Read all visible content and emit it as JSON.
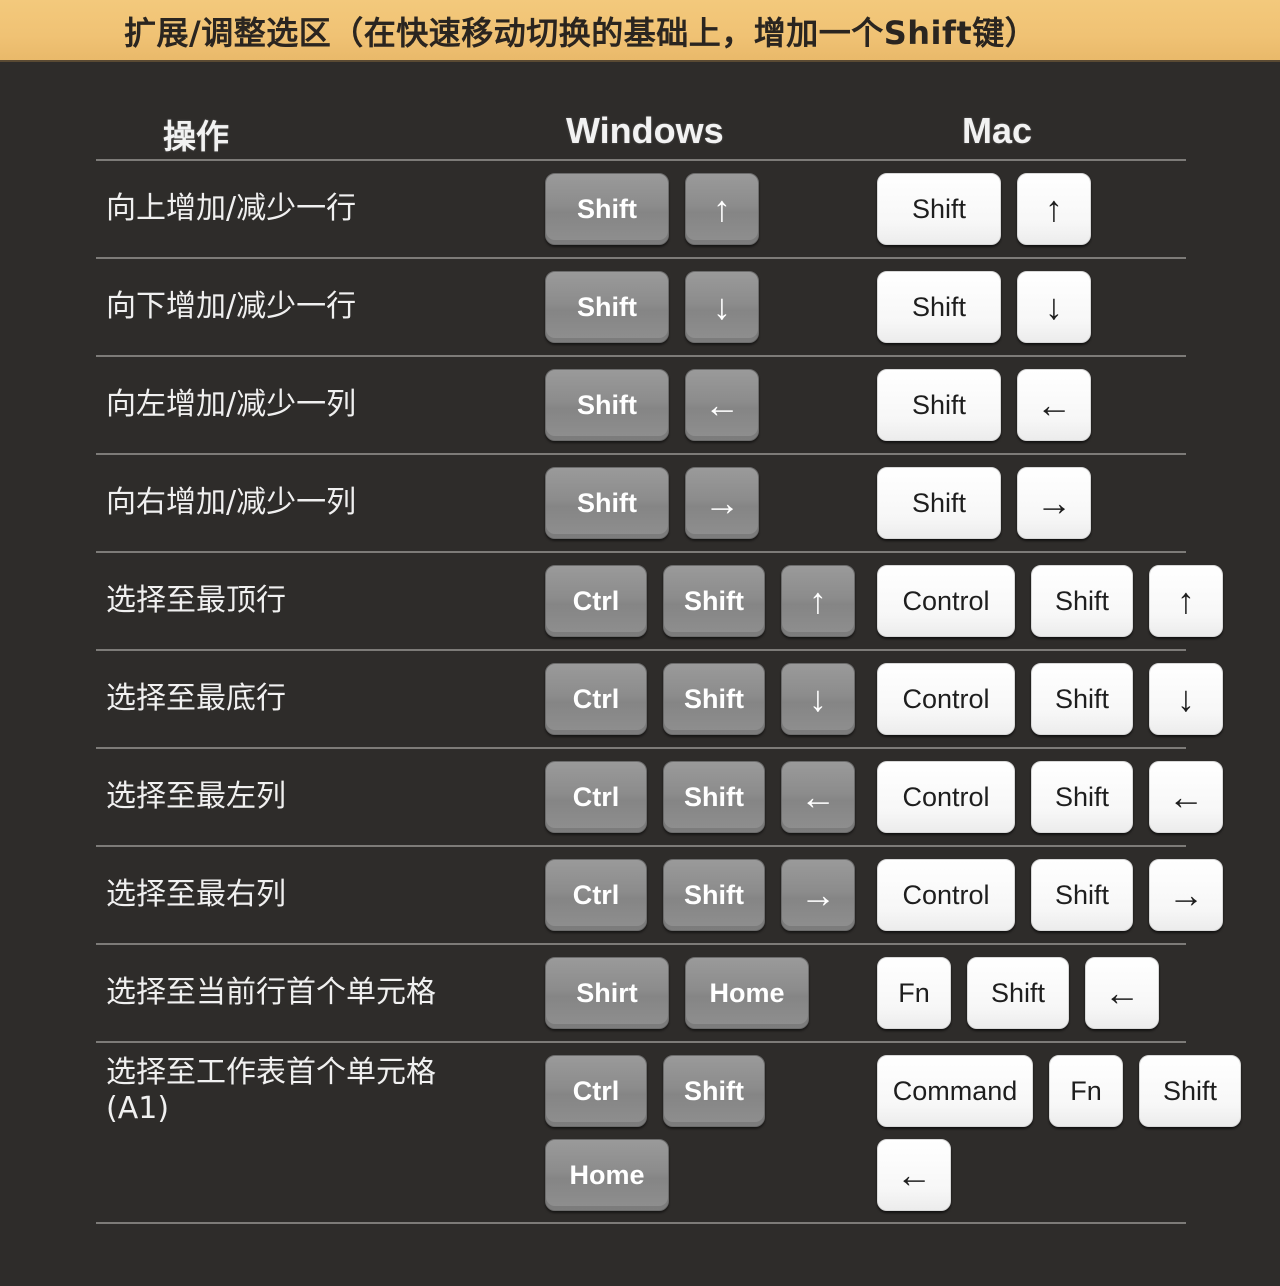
{
  "banner": {
    "title": "扩展/调整选区（在快速移动切换的基础上，增加一个Shift键）"
  },
  "headers": {
    "operation": "操作",
    "windows": "Windows",
    "mac": "Mac"
  },
  "colors": {
    "banner": "#f0c274",
    "background": "#2e2c2a",
    "windows_key": "#8c8c8c",
    "mac_key": "#ffffff",
    "divider": "#7d7b78"
  },
  "rows": [
    {
      "operation": "向上增加/减少一行",
      "windows": [
        "Shift",
        "↑"
      ],
      "mac": [
        "Shift",
        "↑"
      ]
    },
    {
      "operation": "向下增加/减少一行",
      "windows": [
        "Shift",
        "↓"
      ],
      "mac": [
        "Shift",
        "↓"
      ]
    },
    {
      "operation": "向左增加/减少一列",
      "windows": [
        "Shift",
        "←"
      ],
      "mac": [
        "Shift",
        "←"
      ]
    },
    {
      "operation": "向右增加/减少一列",
      "windows": [
        "Shift",
        "→"
      ],
      "mac": [
        "Shift",
        "→"
      ]
    },
    {
      "operation": "选择至最顶行",
      "windows": [
        "Ctrl",
        "Shift",
        "↑"
      ],
      "mac": [
        "Control",
        "Shift",
        "↑"
      ]
    },
    {
      "operation": "选择至最底行",
      "windows": [
        "Ctrl",
        "Shift",
        "↓"
      ],
      "mac": [
        "Control",
        "Shift",
        "↓"
      ]
    },
    {
      "operation": "选择至最左列",
      "windows": [
        "Ctrl",
        "Shift",
        "←"
      ],
      "mac": [
        "Control",
        "Shift",
        "←"
      ]
    },
    {
      "operation": "选择至最右列",
      "windows": [
        "Ctrl",
        "Shift",
        "→"
      ],
      "mac": [
        "Control",
        "Shift",
        "→"
      ]
    },
    {
      "operation": "选择至当前行首个单元格",
      "windows": [
        "Shirt",
        "Home"
      ],
      "mac": [
        "Fn",
        "Shift",
        "←"
      ]
    },
    {
      "operation": "选择至工作表首个单元格",
      "operation_sub": "(A1)",
      "windows": [
        "Ctrl",
        "Shift",
        "Home"
      ],
      "mac": [
        "Command",
        "Fn",
        "Shift",
        "←"
      ]
    }
  ]
}
